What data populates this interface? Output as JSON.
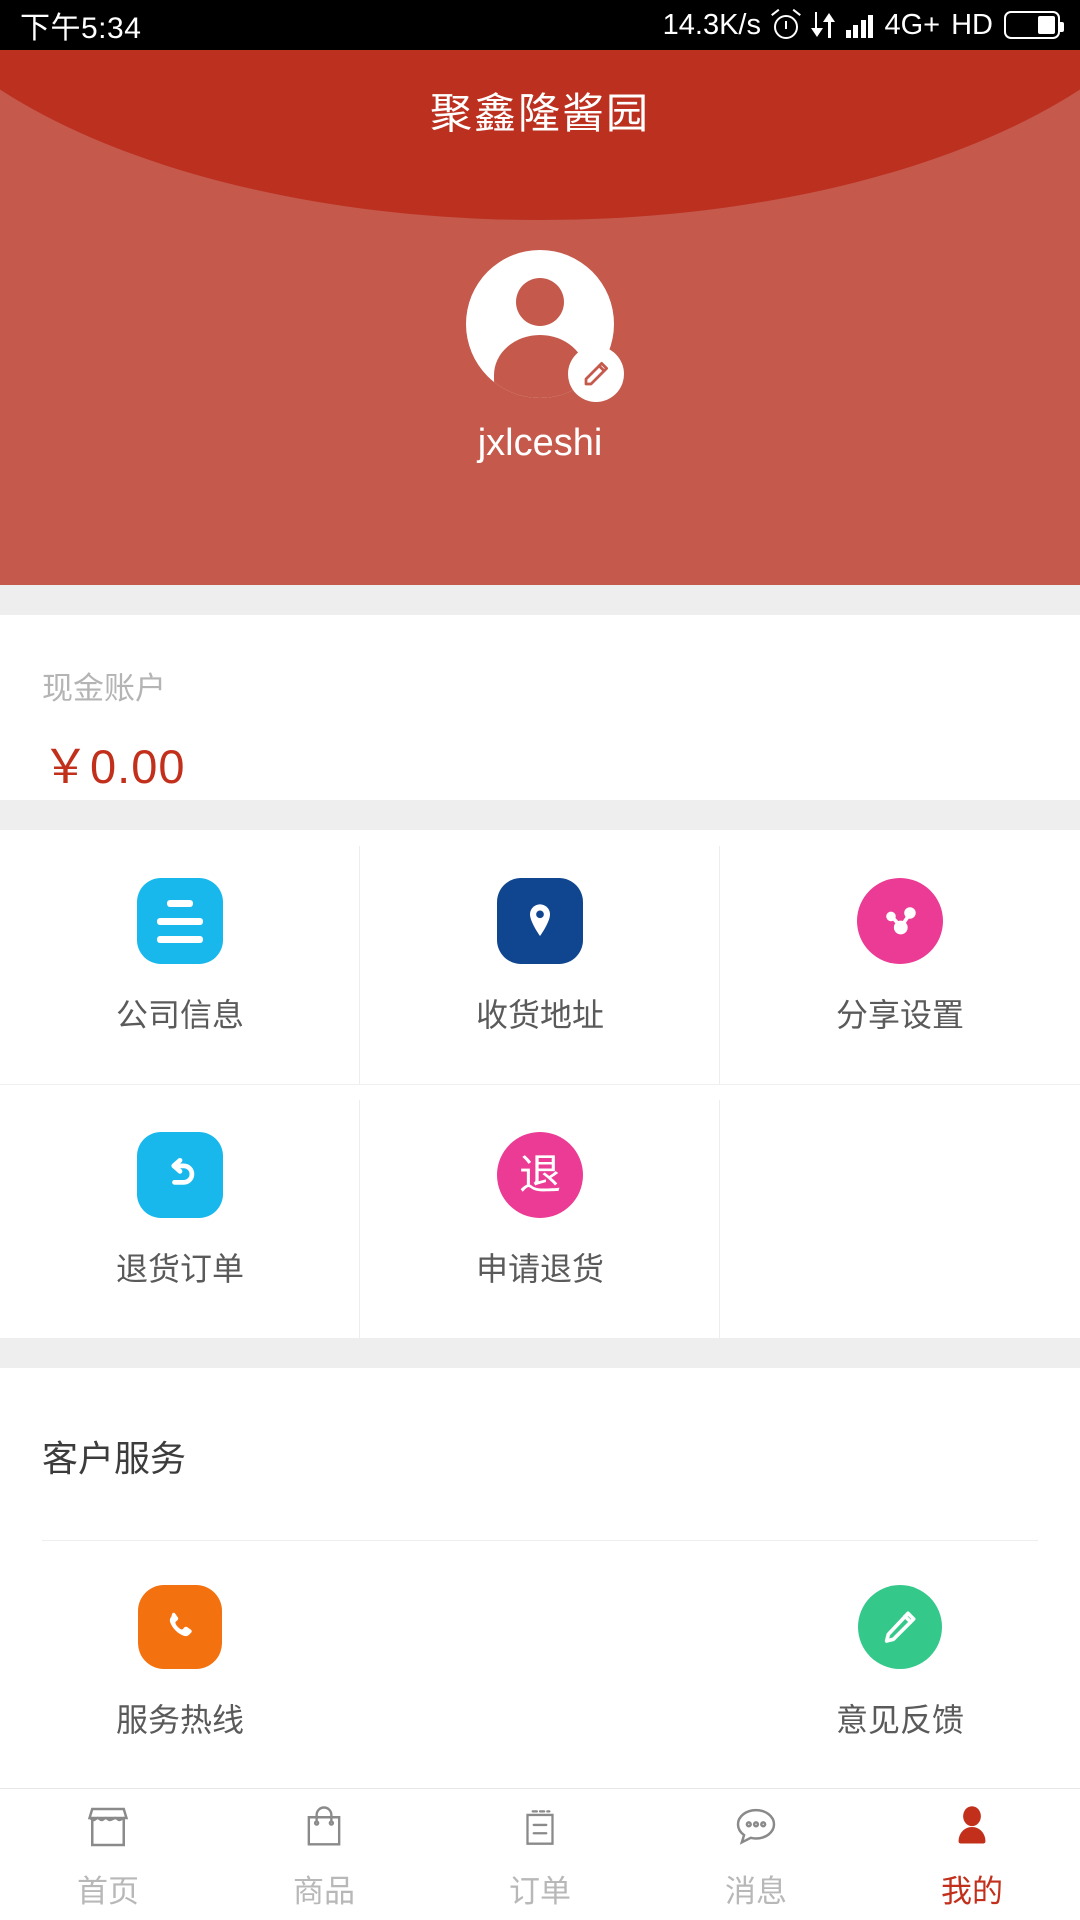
{
  "statusbar": {
    "time": "下午5:34",
    "network_speed": "14.3K/s",
    "network_type": "4G+",
    "hd_label": "HD",
    "icons": [
      "alarm-icon",
      "data-transfer-icon",
      "signal-icon",
      "battery-icon"
    ]
  },
  "header": {
    "title": "聚鑫隆酱园",
    "username": "jxlceshi",
    "avatar_icon": "user-avatar-icon",
    "edit_badge_icon": "edit-pencil-icon",
    "bg_color_top": "#bc3020",
    "bg_color_body": "#c5594c"
  },
  "cash_account": {
    "label": "现金账户",
    "amount": "￥0.00",
    "amount_color": "#c2301c"
  },
  "grid": {
    "rows": [
      [
        {
          "label": "公司信息",
          "icon": "document-icon",
          "color": "#18b8ec",
          "shape": "rounded"
        },
        {
          "label": "收货地址",
          "icon": "location-pin-icon",
          "color": "#10468f",
          "shape": "rounded"
        },
        {
          "label": "分享设置",
          "icon": "share-nodes-icon",
          "color": "#eb3b94",
          "shape": "circle"
        }
      ],
      [
        {
          "label": "退货订单",
          "icon": "return-arrow-icon",
          "color": "#18b8ec",
          "shape": "rounded"
        },
        {
          "label": "申请退货",
          "icon": "refund-char-icon",
          "color": "#eb3b94",
          "shape": "circle",
          "glyph": "退"
        },
        {
          "label": "",
          "icon": "",
          "color": "",
          "shape": ""
        }
      ]
    ]
  },
  "customer_service": {
    "title": "客户服务",
    "items": [
      {
        "label": "服务热线",
        "icon": "phone-icon",
        "color": "#f4710f",
        "shape": "rounded"
      },
      {
        "label": "",
        "icon": "",
        "color": "",
        "shape": ""
      },
      {
        "label": "意见反馈",
        "icon": "pencil-feedback-icon",
        "color": "#34c98a",
        "shape": "circle"
      }
    ]
  },
  "tabbar": {
    "items": [
      {
        "label": "首页",
        "icon": "storefront-icon",
        "active": false
      },
      {
        "label": "商品",
        "icon": "shopping-bag-icon",
        "active": false
      },
      {
        "label": "订单",
        "icon": "order-list-icon",
        "active": false
      },
      {
        "label": "消息",
        "icon": "message-bubble-icon",
        "active": false
      },
      {
        "label": "我的",
        "icon": "person-icon",
        "active": true
      }
    ],
    "active_color": "#c2301c",
    "inactive_color": "#b8b8b8"
  }
}
